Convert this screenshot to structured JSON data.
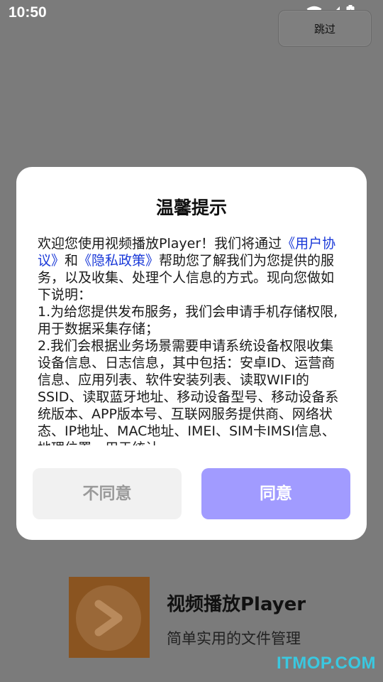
{
  "status_bar": {
    "time": "10:50"
  },
  "skip_button": {
    "label": "跳过"
  },
  "dialog": {
    "title": "温馨提示",
    "body": {
      "intro_before": "欢迎您使用视频播放Player！我们将通过",
      "user_agreement": "《用户协议》",
      "and": "和",
      "privacy_policy": "《隐私政策》",
      "intro_after": "帮助您了解我们为您提供的服务，以及收集、处理个人信息的方式。现向您做如下说明：",
      "item1": "1.为给您提供发布服务，我们会申请手机存储权限,用于数据采集存储；",
      "item2": "2.我们会根据业务场景需要申请系统设备权限收集设备信息、日志信息，其中包括：安卓ID、运营商信息、应用列表、软件安装列表、读取WIFI的SSID、读取蓝牙地址、移动设备型号、移动设备系统版本、APP版本号、互联网服务提供商、网络状态、IP地址、MAC地址、IMEI、SIM卡IMSI信息、地理位置，用于统计"
    },
    "disagree_label": "不同意",
    "agree_label": "同意"
  },
  "app": {
    "name": "视频播放Player",
    "description": "简单实用的文件管理"
  },
  "watermark": "ITMOP.COM",
  "colors": {
    "agree_button": "#a19bff",
    "link": "#1a39d8",
    "watermark": "#3ac8e0"
  }
}
